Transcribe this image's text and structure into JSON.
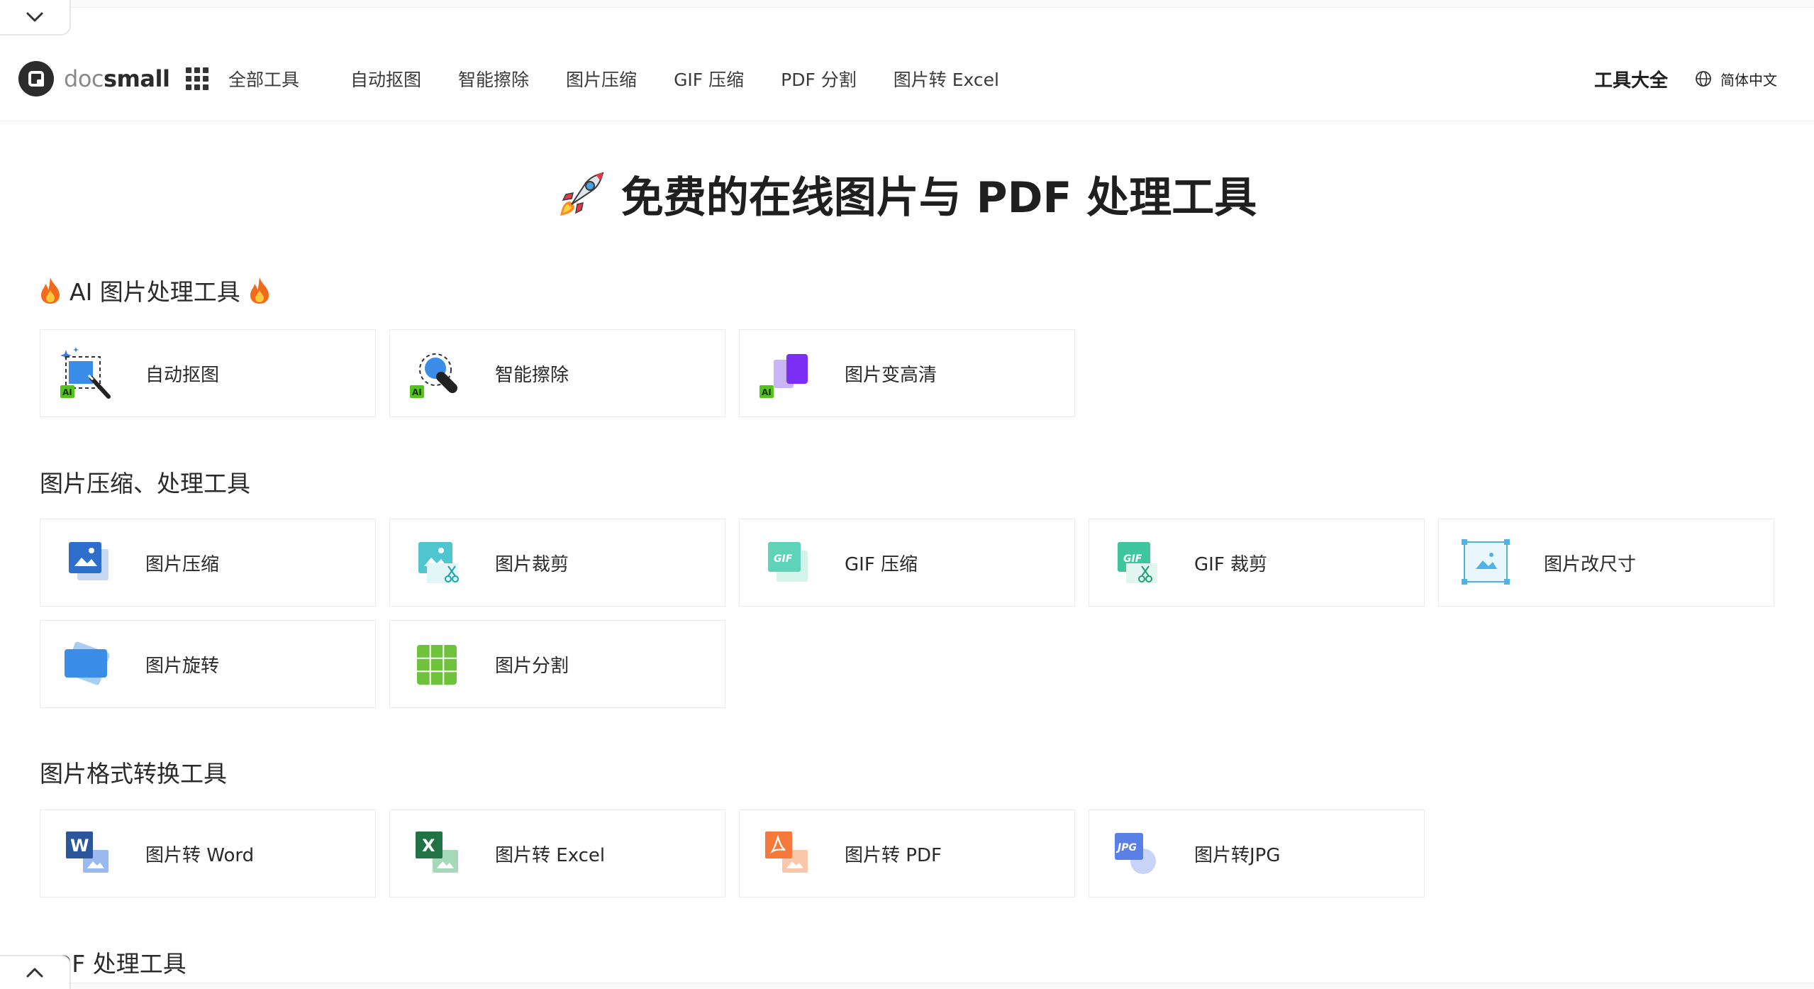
{
  "nav": {
    "logo_a": "doc",
    "logo_b": "small",
    "all_tools": "全部工具",
    "links": [
      "自动抠图",
      "智能擦除",
      "图片压缩",
      "GIF 压缩",
      "PDF 分割",
      "图片转 Excel"
    ],
    "tools_all": "工具大全",
    "language": "简体中文"
  },
  "hero": {
    "title": "免费的在线图片与 PDF 处理工具"
  },
  "sections": {
    "ai": {
      "title": "AI 图片处理工具",
      "items": [
        {
          "label": "自动抠图",
          "icon": "ai-cutout-icon"
        },
        {
          "label": "智能擦除",
          "icon": "ai-erase-icon"
        },
        {
          "label": "图片变高清",
          "icon": "ai-upscale-icon"
        }
      ]
    },
    "compress": {
      "title": "图片压缩、处理工具",
      "items": [
        {
          "label": "图片压缩",
          "icon": "image-compress-icon"
        },
        {
          "label": "图片裁剪",
          "icon": "image-crop-icon"
        },
        {
          "label": "GIF 压缩",
          "icon": "gif-compress-icon"
        },
        {
          "label": "GIF 裁剪",
          "icon": "gif-crop-icon"
        },
        {
          "label": "图片改尺寸",
          "icon": "image-resize-icon"
        },
        {
          "label": "图片旋转",
          "icon": "image-rotate-icon"
        },
        {
          "label": "图片分割",
          "icon": "image-split-icon"
        }
      ]
    },
    "convert": {
      "title": "图片格式转换工具",
      "items": [
        {
          "label": "图片转 Word",
          "icon": "image-to-word-icon"
        },
        {
          "label": "图片转 Excel",
          "icon": "image-to-excel-icon"
        },
        {
          "label": "图片转 PDF",
          "icon": "image-to-pdf-icon"
        },
        {
          "label": "图片转JPG",
          "icon": "image-to-jpg-icon"
        }
      ]
    },
    "pdf": {
      "title": "PDF 处理工具"
    }
  },
  "colors": {
    "ai_badge": "#52c41a",
    "accent_blue": "#3b7ddd",
    "word": "#2b579a",
    "excel": "#217346",
    "pdf": "#f4793a"
  }
}
